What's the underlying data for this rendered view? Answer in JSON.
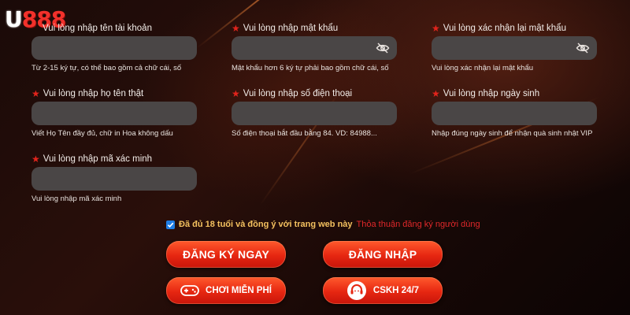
{
  "brand": {
    "logo_u": "U",
    "logo_num": "888"
  },
  "fields": [
    {
      "label": "Vui lòng nhập tên tài khoản",
      "value": "",
      "hint": "Từ 2-15 ký tự, có thể bao gồm cả chữ cái, số"
    },
    {
      "label": "Vui lòng nhập mật khẩu",
      "value": "",
      "hint": "Mật khẩu hơn 6 ký tự phải bao gồm chữ cái, số",
      "icon": "eye-off-icon"
    },
    {
      "label": "Vui lòng xác nhận lại mật khẩu",
      "value": "",
      "hint": "Vui lòng xác nhận lại mật khẩu",
      "icon": "eye-off-icon"
    },
    {
      "label": "Vui lòng nhập họ tên thật",
      "value": "",
      "hint": "Viết Họ Tên đầy đủ, chữ in Hoa không dấu"
    },
    {
      "label": "Vui lòng nhập số điện thoại",
      "value": "",
      "hint": "Số điện thoại bắt đầu bằng 84. VD: 84988..."
    },
    {
      "label": "Vui lòng nhập ngày sinh",
      "value": "",
      "hint": "Nhập đúng ngày sinh để nhận quà sinh nhật VIP"
    },
    {
      "label": "Vui lòng nhập mã xác minh",
      "value": "",
      "hint": "Vui lòng nhập mã xác minh"
    }
  ],
  "agreement": {
    "checked": true,
    "text": "Đã đủ 18 tuổi và đồng ý với trang web này",
    "link": "Thỏa thuận đăng ký người dùng"
  },
  "buttons": {
    "register": "ĐĂNG KÝ NGAY",
    "login": "ĐĂNG NHẬP",
    "free_play": "CHƠI MIỄN PHÍ",
    "support": "CSKH 24/7"
  },
  "colors": {
    "accent_red": "#e62611",
    "star_red": "#e2241c",
    "agree_gold": "#f4c15f",
    "input_bg": "#4a4646",
    "checkbox_blue": "#1f7ee6"
  }
}
